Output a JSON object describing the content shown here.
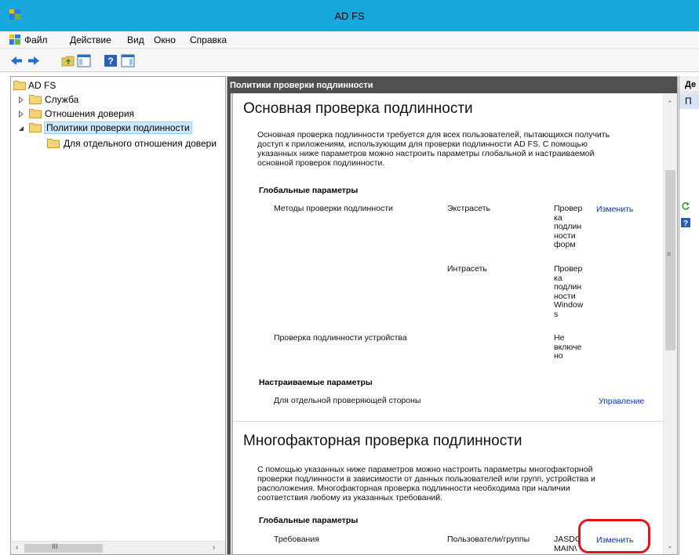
{
  "window": {
    "title": "AD FS"
  },
  "menu": [
    "Файл",
    "Действие",
    "Вид",
    "Окно",
    "Справка"
  ],
  "tree": {
    "root": "AD FS",
    "items": [
      "Служба",
      "Отношения доверия",
      "Политики проверки подлинности"
    ],
    "child": "Для отдельного отношения довери",
    "hscroll_glyph": "III"
  },
  "center": {
    "header": "Политики проверки подлинности",
    "primary": {
      "title": "Основная проверка подлинности",
      "description": [
        "Основная проверка подлинности требуется для всех пользователей, пытающихся получить",
        "доступ к приложениям, использующим для проверки подлинности AD FS. С помощью",
        "указанных ниже параметров можно настроить параметры глобальной и настраиваемой",
        "основной проверок подлинности."
      ],
      "global_heading": "Глобальные параметры",
      "auth_methods_label": "Методы проверки подлинности",
      "extranet_label": "Экстрасеть",
      "extranet_value": [
        "Провер",
        "ка",
        "подлин",
        "ности",
        "форм"
      ],
      "edit_link": "Изменить",
      "intranet_label": "Интрасеть",
      "intranet_value": [
        "Провер",
        "ка",
        "подлин",
        "ности",
        "Window",
        "s"
      ],
      "device_label": "Проверка подлинности устройства",
      "device_value": [
        "Не",
        "включе",
        "но"
      ],
      "custom_heading": "Настраиваемые параметры",
      "per_rp_label": "Для отдельной проверяющей стороны",
      "manage_link": "Управление"
    },
    "mfa": {
      "title": "Многофакторная проверка подлинности",
      "description": [
        "С помощью указанных ниже параметров можно настроить параметры многофакторной",
        "проверки подлинности в зависимости от данных пользователей или групп, устройства и",
        "расположения. Многофакторная проверка подлинности необходима при наличии",
        "соответствия любому из указанных требований."
      ],
      "global_heading": "Глобальные параметры",
      "requirements_label": "Требования",
      "users_groups_label": "Пользователи/группы",
      "users_value": [
        "JASDC",
        "MAIN\\"
      ],
      "edit_link": "Изменить"
    }
  },
  "actions": {
    "header": "Де",
    "subheader": "П"
  },
  "colors": {
    "titlebar": "#17a9dd",
    "highlight": "#e4141b",
    "link": "#0033cc"
  }
}
